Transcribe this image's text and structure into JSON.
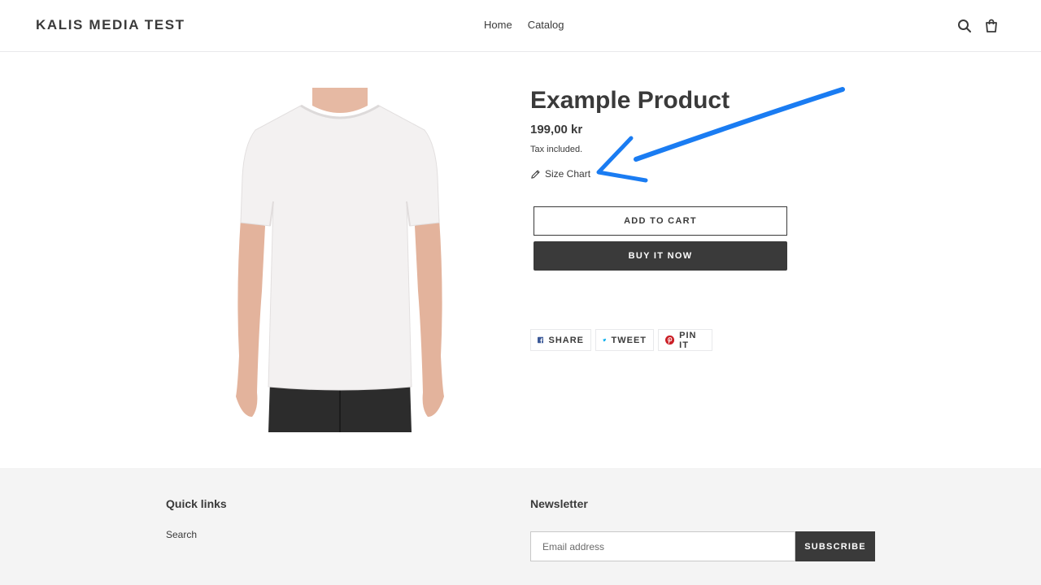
{
  "header": {
    "site_title": "KALIS MEDIA TEST",
    "nav": [
      {
        "label": "Home"
      },
      {
        "label": "Catalog"
      }
    ],
    "icons": [
      "search-icon",
      "cart-icon"
    ]
  },
  "product": {
    "title": "Example Product",
    "price": "199,00 kr",
    "tax_note": "Tax included.",
    "size_chart_label": "Size Chart",
    "add_to_cart_label": "ADD TO CART",
    "buy_now_label": "BUY IT NOW",
    "share": [
      {
        "label": "SHARE",
        "icon": "facebook-icon",
        "color": "#3b5998"
      },
      {
        "label": "TWEET",
        "icon": "twitter-icon",
        "color": "#00aced"
      },
      {
        "label": "PIN IT",
        "icon": "pinterest-icon",
        "color": "#cb2027"
      }
    ]
  },
  "footer": {
    "quick_links_heading": "Quick links",
    "links": [
      {
        "label": "Search"
      }
    ],
    "newsletter_heading": "Newsletter",
    "email_placeholder": "Email address",
    "subscribe_label": "SUBSCRIBE"
  },
  "colors": {
    "text": "#3a3a3a",
    "annotation_arrow": "#1a7cf2",
    "footer_bg": "#f4f4f4"
  }
}
